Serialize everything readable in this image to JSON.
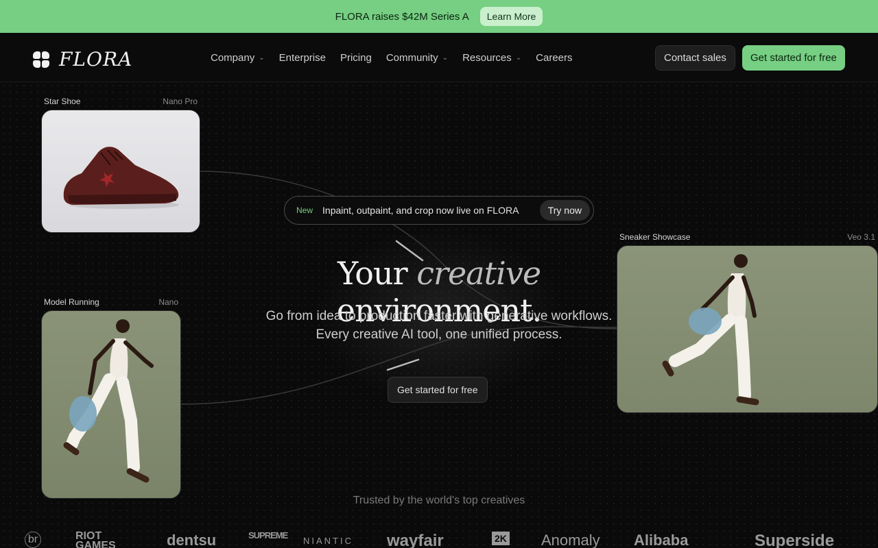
{
  "announcement": {
    "text": "FLORA raises $42M Series A",
    "button": "Learn More"
  },
  "nav": {
    "logo_text": "FLORA",
    "items": [
      {
        "label": "Company",
        "dropdown": true
      },
      {
        "label": "Enterprise",
        "dropdown": false
      },
      {
        "label": "Pricing",
        "dropdown": false
      },
      {
        "label": "Community",
        "dropdown": true
      },
      {
        "label": "Resources",
        "dropdown": true
      },
      {
        "label": "Careers",
        "dropdown": false
      }
    ],
    "contact_sales": "Contact sales",
    "get_started": "Get started for free"
  },
  "cards": {
    "star_shoe": {
      "title": "Star Shoe",
      "model": "Nano Pro"
    },
    "model_running": {
      "title": "Model Running",
      "model": "Nano"
    },
    "sneaker_showcase": {
      "title": "Sneaker Showcase",
      "model": "Veo 3.1"
    }
  },
  "hero": {
    "badge_new": "New",
    "badge_text": "Inpaint, outpaint, and crop now live on FLORA",
    "badge_button": "Try now",
    "headline_before": "Your",
    "headline_emphasis": "creative",
    "headline_after": "environment.",
    "subtitle_line1": "Go from idea to production faster with generative workflows.",
    "subtitle_line2": "Every creative AI tool, one unified process.",
    "cta": "Get started for free"
  },
  "trusted": {
    "label": "Trusted by the world's top creatives",
    "logos": [
      "br",
      "RIOT GAMES",
      "dentsu",
      "SUPREME",
      "NIANTIC",
      "wayfair",
      "2K",
      "Anomaly",
      "Alibaba",
      "Superside"
    ]
  },
  "colors": {
    "accent_green": "#76cf82",
    "background": "#0a0a0a"
  }
}
